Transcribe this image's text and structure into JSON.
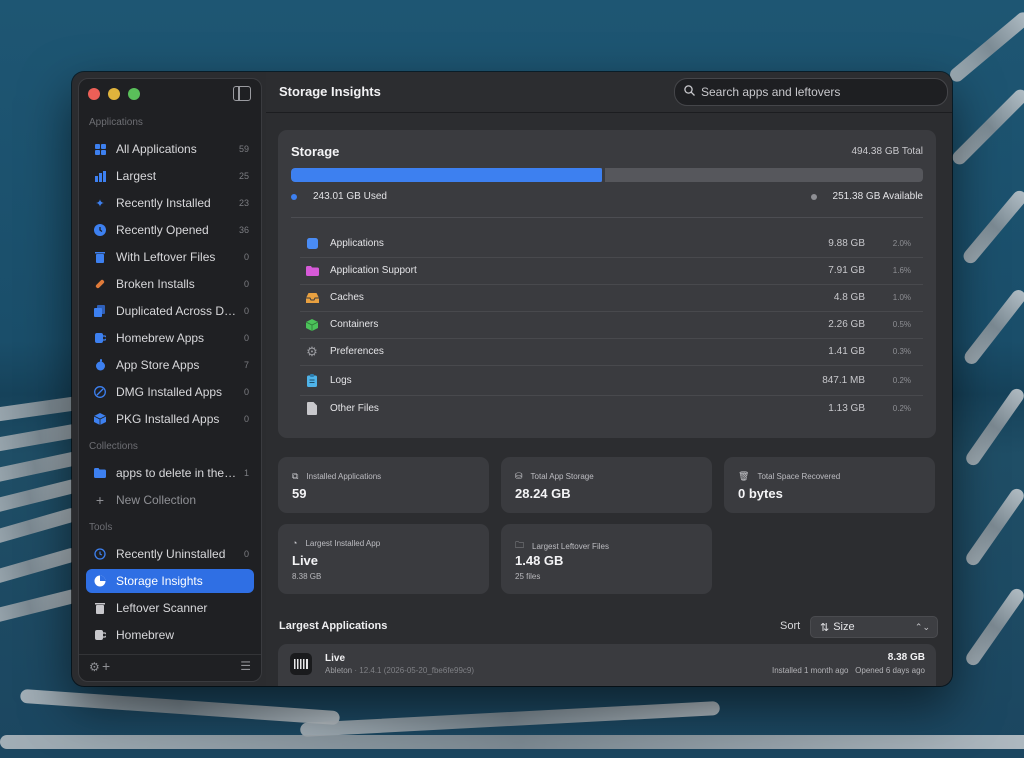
{
  "sidebar": {
    "sections": {
      "applications": "Applications",
      "collections": "Collections",
      "tools": "Tools"
    },
    "applications": [
      {
        "label": "All Applications",
        "count": "59",
        "icon": "grid-icon",
        "color": "#3d80f0"
      },
      {
        "label": "Largest",
        "count": "25",
        "icon": "bar-chart-icon",
        "color": "#3d80f0"
      },
      {
        "label": "Recently Installed",
        "count": "23",
        "icon": "sparkle-icon",
        "color": "#3d80f0"
      },
      {
        "label": "Recently Opened",
        "count": "36",
        "icon": "clock-icon",
        "color": "#3d80f0"
      },
      {
        "label": "With Leftover Files",
        "count": "0",
        "icon": "trash-icon",
        "color": "#3d80f0"
      },
      {
        "label": "Broken Installs",
        "count": "0",
        "icon": "bandage-icon",
        "color": "#e07b3a"
      },
      {
        "label": "Duplicated Across Dri...",
        "count": "0",
        "icon": "duplicate-icon",
        "color": "#3d80f0"
      },
      {
        "label": "Homebrew Apps",
        "count": "0",
        "icon": "mug-icon",
        "color": "#3d80f0"
      },
      {
        "label": "App Store Apps",
        "count": "7",
        "icon": "apple-icon",
        "color": "#3d80f0"
      },
      {
        "label": "DMG Installed Apps",
        "count": "0",
        "icon": "disk-icon",
        "color": "#3d80f0"
      },
      {
        "label": "PKG Installed Apps",
        "count": "0",
        "icon": "package-icon",
        "color": "#3d80f0"
      }
    ],
    "collections": [
      {
        "label": "apps to delete in the f...",
        "count": "1",
        "icon": "folder-icon"
      },
      {
        "label": "New Collection",
        "count": "",
        "icon": "plus-icon"
      }
    ],
    "tools": [
      {
        "label": "Recently Uninstalled",
        "count": "0",
        "icon": "history-icon"
      },
      {
        "label": "Storage Insights",
        "count": "",
        "icon": "pie-chart-icon",
        "active": true
      },
      {
        "label": "Leftover Scanner",
        "count": "",
        "icon": "trash-scan-icon"
      },
      {
        "label": "Homebrew",
        "count": "",
        "icon": "mug-icon"
      }
    ]
  },
  "header": {
    "title": "Storage Insights",
    "search_placeholder": "Search apps and leftovers"
  },
  "storage": {
    "heading": "Storage",
    "total": "494.38 GB Total",
    "used_label": "243.01 GB Used",
    "available_label": "251.38 GB Available",
    "used_fraction": 0.4915,
    "used_color": "#3d80f0",
    "available_color": "#8e8f94",
    "categories": [
      {
        "name": "Applications",
        "size": "9.88 GB",
        "percent": "2.0%",
        "icon": "app-square-icon",
        "color": "#4a8cf5"
      },
      {
        "name": "Application Support",
        "size": "7.91 GB",
        "percent": "1.6%",
        "icon": "folder-icon",
        "color": "#d65ad8"
      },
      {
        "name": "Caches",
        "size": "4.8 GB",
        "percent": "1.0%",
        "icon": "tray-icon",
        "color": "#e8a040"
      },
      {
        "name": "Containers",
        "size": "2.26 GB",
        "percent": "0.5%",
        "icon": "cube-icon",
        "color": "#4cc25a"
      },
      {
        "name": "Preferences",
        "size": "1.41 GB",
        "percent": "0.3%",
        "icon": "gear-icon",
        "color": "#9a9ba0"
      },
      {
        "name": "Logs",
        "size": "847.1 MB",
        "percent": "0.2%",
        "icon": "clipboard-icon",
        "color": "#4fb3e8"
      },
      {
        "name": "Other Files",
        "size": "1.13 GB",
        "percent": "0.2%",
        "icon": "document-icon",
        "color": "#c8c8cc"
      }
    ]
  },
  "stats": [
    {
      "label": "Installed Applications",
      "value": "59",
      "sub": "",
      "icon": "app-store-icon"
    },
    {
      "label": "Total App Storage",
      "value": "28.24 GB",
      "sub": "",
      "icon": "drive-icon"
    },
    {
      "label": "Total Space Recovered",
      "value": "0 bytes",
      "sub": "",
      "icon": "trash-icon"
    },
    {
      "label": "Largest Installed App",
      "value": "Live",
      "sub": "8.38 GB",
      "icon": "arrow-up-circle-icon"
    },
    {
      "label": "Largest Leftover Files",
      "value": "1.48 GB",
      "sub": "25 files",
      "icon": "folder-badge-icon"
    }
  ],
  "largest": {
    "title": "Largest Applications",
    "sort_label": "Sort",
    "sort_value": "Size",
    "apps": [
      {
        "name": "Live",
        "vendor": "Ableton",
        "version": "· 12.4.1 (2026-05-20_fbe6fe99c9)",
        "size": "8.38 GB",
        "installed": "Installed 1 month ago",
        "opened": "Opened 6 days ago"
      }
    ]
  }
}
